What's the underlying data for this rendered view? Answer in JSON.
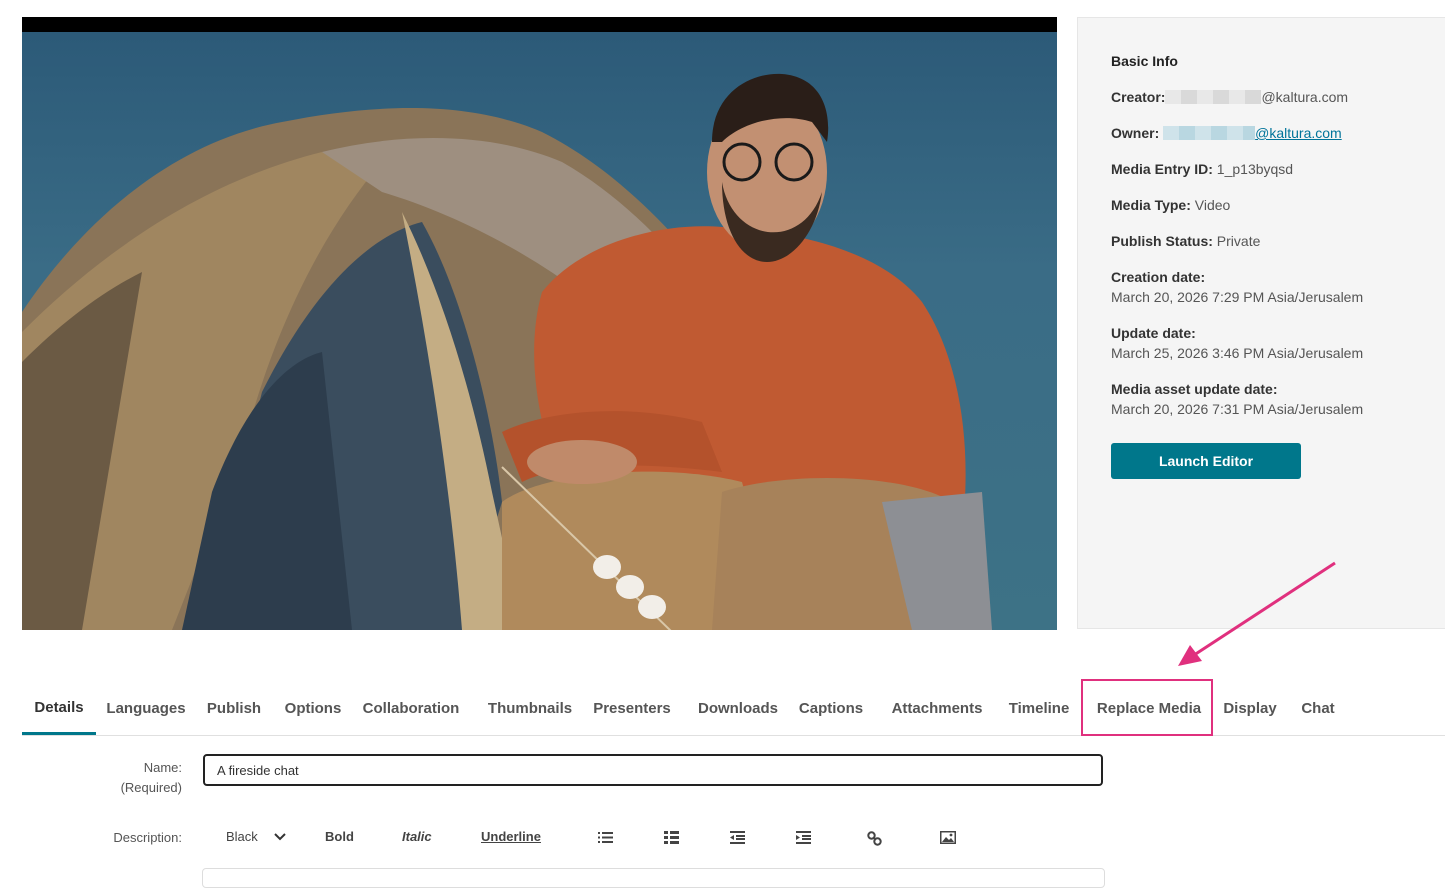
{
  "basic_info": {
    "title": "Basic Info",
    "creator_label": "Creator:",
    "creator_value": "@kaltura.com",
    "owner_label": "Owner:",
    "owner_value": "@kaltura.com",
    "entry_id_label": "Media Entry ID:",
    "entry_id_value": "1_p13byqsd",
    "type_label": "Media Type:",
    "type_value": "Video",
    "status_label": "Publish Status:",
    "status_value": "Private",
    "created_label": "Creation date:",
    "created_value": "March 20, 2026 7:29 PM Asia/Jerusalem",
    "updated_label": "Update date:",
    "updated_value": "March 25, 2026 3:46 PM Asia/Jerusalem",
    "asset_updated_label": "Media asset update date:",
    "asset_updated_value": "March 20, 2026 7:31 PM Asia/Jerusalem",
    "launch_button": "Launch Editor"
  },
  "tabs": [
    "Details",
    "Languages",
    "Publish",
    "Options",
    "Collaboration",
    "Thumbnails",
    "Presenters",
    "Downloads",
    "Captions",
    "Attachments",
    "Timeline",
    "Replace Media",
    "Display",
    "Chat"
  ],
  "form": {
    "name_label": "Name:",
    "name_required": "(Required)",
    "name_value": "A fireside chat",
    "description_label": "Description:",
    "toolbar": {
      "color": "Black",
      "bold": "Bold",
      "italic": "Italic",
      "underline": "Underline"
    }
  },
  "colors": {
    "accent": "#00778b",
    "highlight": "#e0307e"
  }
}
